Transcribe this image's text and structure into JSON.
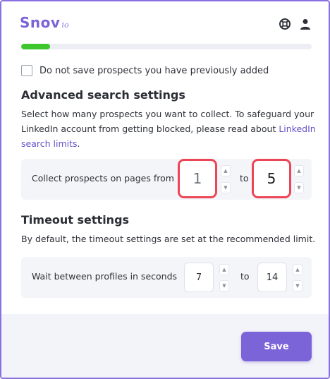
{
  "header": {
    "logo_main": "Snov",
    "logo_sup": "io",
    "help_icon": "lifebuoy-icon",
    "user_icon": "user-icon"
  },
  "progress": {
    "fraction": 0.1,
    "color": "#3dc72c"
  },
  "options": {
    "skip_previous": {
      "label": "Do not save prospects you have previously added",
      "checked": false
    }
  },
  "advanced": {
    "title": "Advanced search settings",
    "description": "Select how many prospects you want to collect. To safeguard your LinkedIn account from getting blocked, please read about ",
    "link_text": "LinkedIn search limits",
    "description_end": ".",
    "pages_label": "Collect prospects on pages from",
    "from_value": "1",
    "to_label": "to",
    "to_value": "5"
  },
  "timeout": {
    "title": "Timeout settings",
    "description": "By default, the timeout settings are set at the recommended limit.",
    "wait_label": "Wait between profiles in seconds",
    "from_value": "7",
    "to_label": "to",
    "to_value": "14"
  },
  "footer": {
    "save_label": "Save"
  },
  "colors": {
    "accent": "#7b63d8",
    "highlight": "#ec4656"
  }
}
